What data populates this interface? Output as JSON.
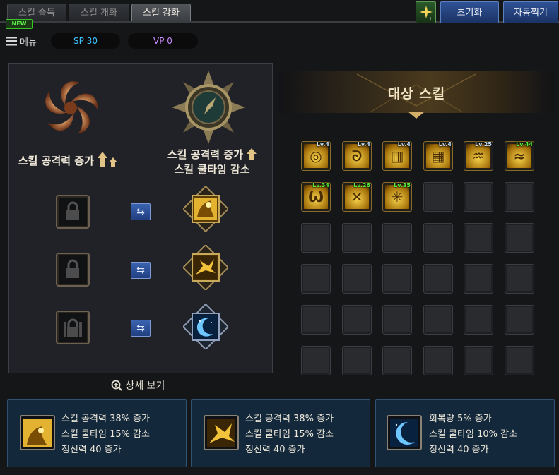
{
  "tabs": [
    {
      "label": "스킬 습득",
      "active": false
    },
    {
      "label": "스킬 개화",
      "active": false
    },
    {
      "label": "스킬 강화",
      "active": true
    }
  ],
  "new_badge": "NEW",
  "top_buttons": {
    "reset": "초기화",
    "auto": "자동찍기"
  },
  "menu": {
    "label": "메뉴",
    "sp": "SP 30",
    "vp": "VP 0"
  },
  "left_panel": {
    "title_left": "스킬 공격력 증가",
    "title_right_line1": "스킬 공격력 증가",
    "title_right_line2": "스킬 쿨타임 감소",
    "rows": [
      {
        "locked": true,
        "skill_icon": "golden-warrior-icon"
      },
      {
        "locked": true,
        "skill_icon": "golden-burst-icon"
      },
      {
        "locked": true,
        "skill_icon": "crescent-moon-icon"
      }
    ]
  },
  "detail_view": "상세 보기",
  "target_skill": {
    "title": "대상 스킬",
    "slots": [
      {
        "lv": "Lv.4",
        "level_color": "blue"
      },
      {
        "lv": "Lv.4",
        "level_color": "blue"
      },
      {
        "lv": "Lv.4",
        "level_color": "blue"
      },
      {
        "lv": "Lv.4",
        "level_color": "blue"
      },
      {
        "lv": "Lv.25",
        "level_color": "blue"
      },
      {
        "lv": "Lv.44",
        "level_color": "green"
      },
      {
        "lv": "Lv.34",
        "level_color": "green"
      },
      {
        "lv": "Lv.26",
        "level_color": "green"
      },
      {
        "lv": "Lv.35",
        "level_color": "green"
      }
    ],
    "total_slots": 36
  },
  "cards": [
    {
      "lines": [
        "스킬 공격력 38% 증가",
        "스킬 쿨타임 15% 감소",
        "정신력 40 증가"
      ],
      "icon": "golden-warrior-icon"
    },
    {
      "lines": [
        "스킬 공격력 38% 증가",
        "스킬 쿨타임 15% 감소",
        "정신력 40 증가"
      ],
      "icon": "golden-burst-icon"
    },
    {
      "lines": [
        "회복량 5% 증가",
        "스킬 쿨타임 10% 감소",
        "정신력 40 증가"
      ],
      "icon": "crescent-moon-icon"
    }
  ],
  "colors": {
    "accent_gold": "#c89a3a",
    "button_blue": "#2f5294",
    "sp_text": "#3ec4ff",
    "vp_text": "#c98bff",
    "level_green": "#53f53b",
    "level_blue": "#bfe0ff"
  }
}
